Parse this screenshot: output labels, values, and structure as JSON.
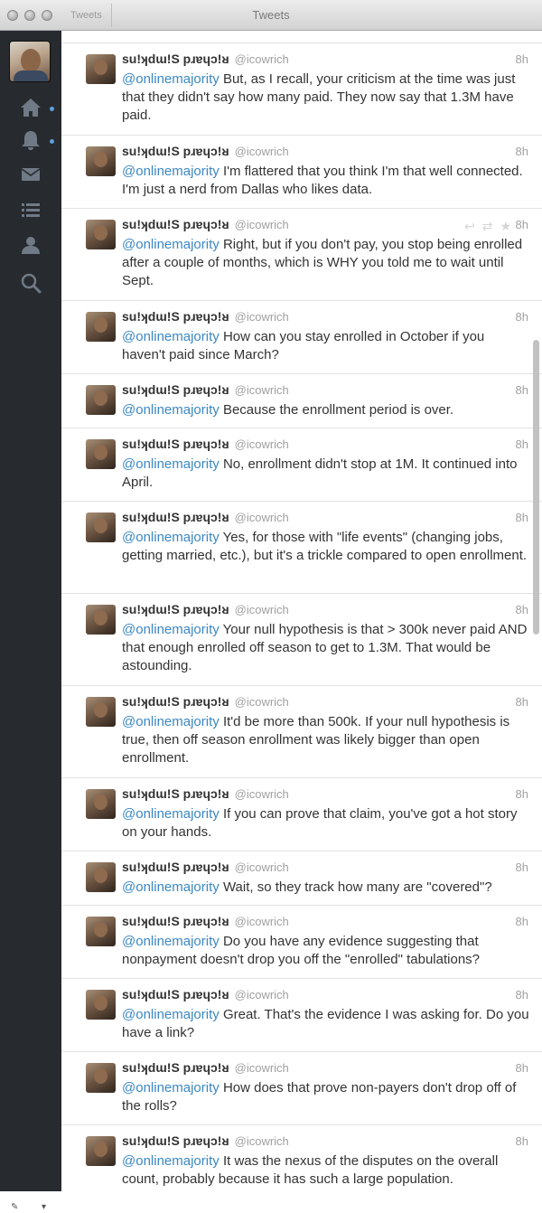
{
  "window": {
    "title": "Tweets",
    "tab_label": "Tweets"
  },
  "sidebar": {
    "nav": [
      {
        "name": "home-icon",
        "has_dot": true
      },
      {
        "name": "mentions-icon",
        "has_dot": true
      },
      {
        "name": "messages-icon",
        "has_dot": false
      },
      {
        "name": "lists-icon",
        "has_dot": false
      },
      {
        "name": "profile-icon",
        "has_dot": false
      },
      {
        "name": "search-icon",
        "has_dot": false
      }
    ]
  },
  "author": {
    "name": "su!ʞdɯ!S pɹɐɥɔ!ᴚ",
    "handle": "@icowrich"
  },
  "tweets": [
    {
      "mention": "@onlinemajority",
      "text": " But, as I recall, your criticism at the time was just that they didn't say how many paid. They now say that 1.3M have paid.",
      "time": "8h"
    },
    {
      "mention": "@onlinemajority",
      "text": " I'm flattered that you think I'm that well connected. I'm just a nerd from Dallas who likes data.",
      "time": "8h"
    },
    {
      "mention": "@onlinemajority",
      "text": " Right, but if you don't pay, you stop being enrolled after a couple of months, which is WHY you told me to wait until Sept.",
      "time": "8h"
    },
    {
      "mention": "@onlinemajority",
      "text": " How can you stay enrolled in October if you haven't paid since March?",
      "time": "8h"
    },
    {
      "mention": "@onlinemajority",
      "text": " Because the enrollment period is over.",
      "time": "8h"
    },
    {
      "mention": "@onlinemajority",
      "text": " No, enrollment didn't stop at 1M. It continued into April.",
      "time": "8h"
    },
    {
      "mention": "@onlinemajority",
      "text": " Yes, for those with \"life events\" (changing jobs, getting married, etc.), but it's a trickle compared to open enrollment.",
      "time": "8h"
    },
    {
      "mention": "@onlinemajority",
      "text": " Your null hypothesis is that > 300k never paid AND that enough enrolled off season to get to 1.3M. That would be astounding.",
      "time": "8h"
    },
    {
      "mention": "@onlinemajority",
      "text": " It'd be more than 500k. If your null hypothesis is true, then off season enrollment was likely bigger than open enrollment.",
      "time": "8h"
    },
    {
      "mention": "@onlinemajority",
      "text": " If you can prove that claim, you've got a hot story on your hands.",
      "time": "8h"
    },
    {
      "mention": "@onlinemajority",
      "text": " Wait, so they track how many are \"covered\"?",
      "time": "8h"
    },
    {
      "mention": "@onlinemajority",
      "text": " Do you have any evidence suggesting that nonpayment doesn't drop you off the \"enrolled\" tabulations?",
      "time": "8h"
    },
    {
      "mention": "@onlinemajority",
      "text": " Great.  That's the evidence I was asking for. Do you have a link?",
      "time": "8h"
    },
    {
      "mention": "@onlinemajority",
      "text": " How does that prove non-payers don't drop off of the rolls?",
      "time": "8h"
    },
    {
      "mention": "@onlinemajority",
      "text": " It was the nexus of the disputes on the overall count, probably because it has such a large population.",
      "time": "8h"
    }
  ]
}
